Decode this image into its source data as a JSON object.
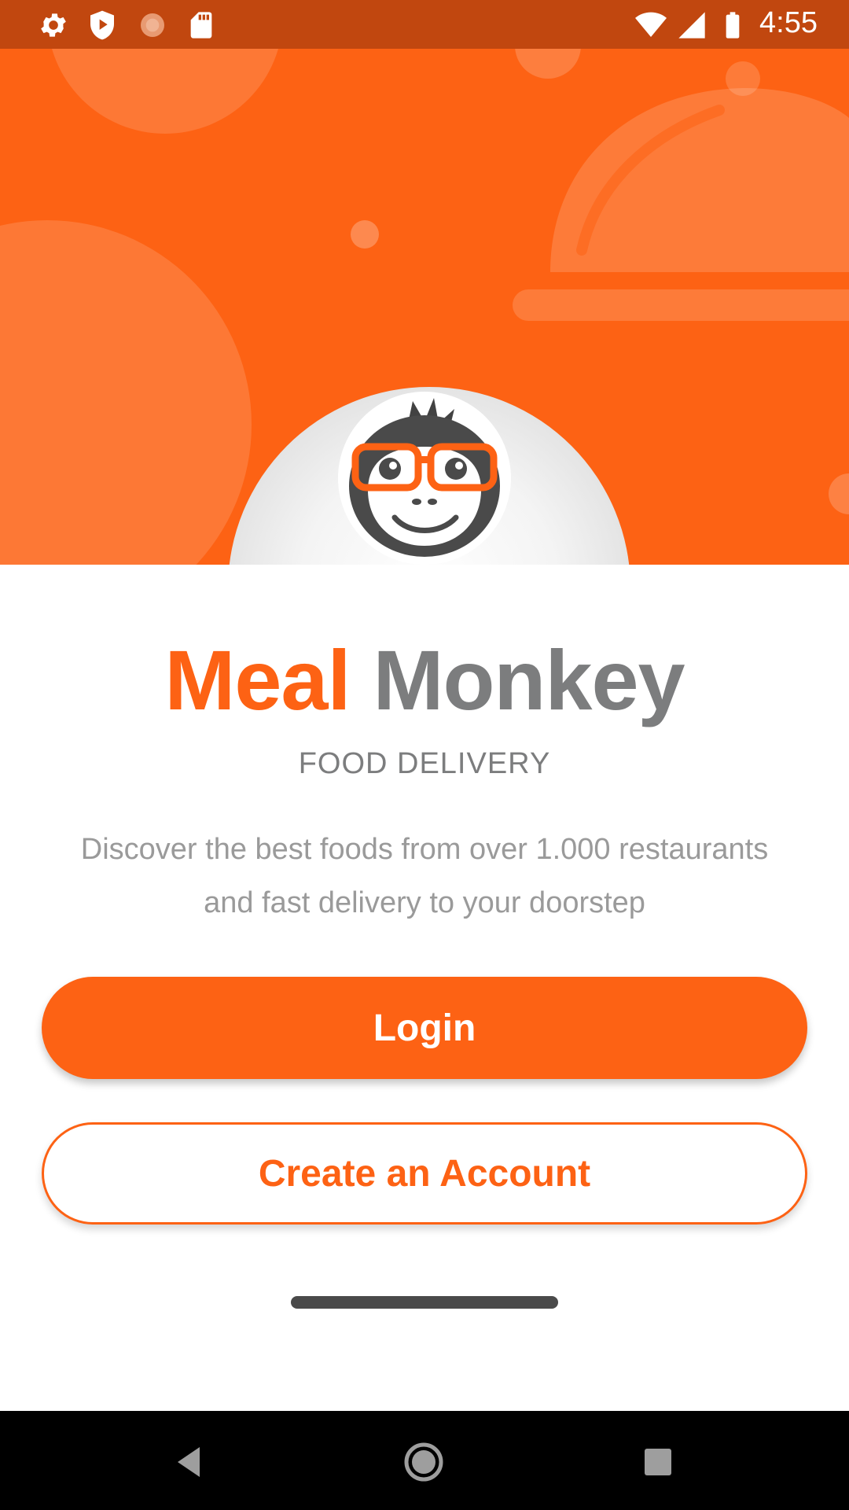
{
  "status_bar": {
    "time": "4:55",
    "left_icons": [
      "gear-icon",
      "shield-play-icon",
      "loading-icon",
      "sd-card-icon"
    ],
    "right_icons": [
      "wifi-icon",
      "cell-signal-icon",
      "battery-icon"
    ]
  },
  "hero": {
    "background_color": "#fd6214",
    "decoration": "cloche-icon",
    "logo": "monkey-logo"
  },
  "brand": {
    "part1": "Meal",
    "part2": "Monkey",
    "part1_color": "#fd6214",
    "part2_color": "#7c7d7e"
  },
  "tagline": "FOOD DELIVERY",
  "description": "Discover the best foods from over 1.000 restaurants and fast delivery to your doorstep",
  "buttons": {
    "login": "Login",
    "create_account": "Create an Account"
  },
  "nav_bar": {
    "icons": [
      "back-icon",
      "home-icon",
      "recents-icon"
    ]
  }
}
